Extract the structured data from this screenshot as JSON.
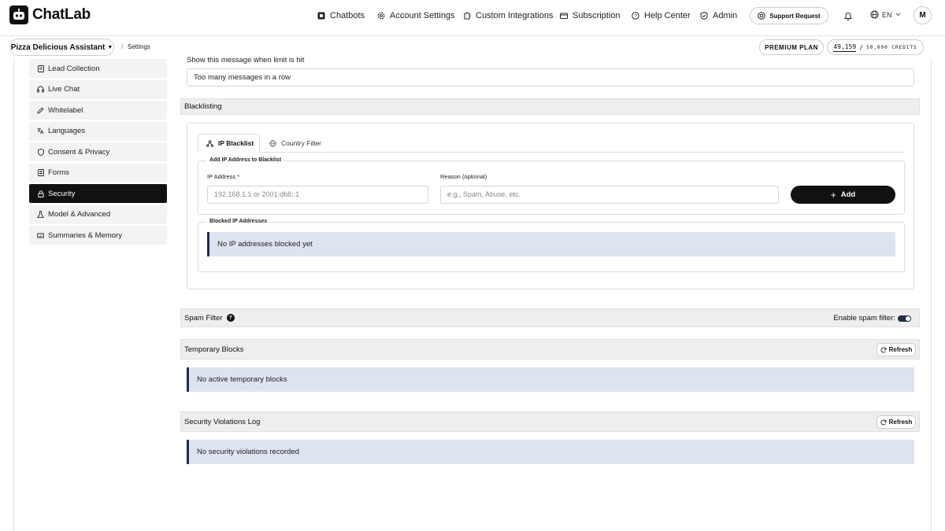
{
  "app": {
    "name": "ChatLab"
  },
  "nav": {
    "chatbots": "Chatbots",
    "account_settings": "Account Settings",
    "custom_integrations": "Custom Integrations",
    "subscription": "Subscription",
    "help_center": "Help Center",
    "admin": "Admin"
  },
  "header": {
    "support_request": "Support Request",
    "language": "EN",
    "avatar_initial": "M"
  },
  "subbar": {
    "bot_name": "Pizza Delicious Assistant",
    "breadcrumb": "Settings",
    "plan": "PREMIUM PLAN",
    "credits_used": "49,159",
    "credits_total": "50,000 CREDITS"
  },
  "sidebar": {
    "items": [
      {
        "label": "Lead Collection",
        "icon": "document-icon",
        "active": false
      },
      {
        "label": "Live Chat",
        "icon": "headset-icon",
        "active": false
      },
      {
        "label": "Whitelabel",
        "icon": "pen-icon",
        "active": false
      },
      {
        "label": "Languages",
        "icon": "translate-icon",
        "active": false
      },
      {
        "label": "Consent & Privacy",
        "icon": "shield-icon",
        "active": false
      },
      {
        "label": "Forms",
        "icon": "form-icon",
        "active": false
      },
      {
        "label": "Security",
        "icon": "lock-icon",
        "active": true
      },
      {
        "label": "Model & Advanced",
        "icon": "flask-icon",
        "active": false
      },
      {
        "label": "Summaries & Memory",
        "icon": "keyboard-icon",
        "active": false
      }
    ]
  },
  "rate_limit": {
    "message_label": "Show this message when limit is hit",
    "message_value": "Too many messages in a row"
  },
  "blacklisting": {
    "title": "Blacklisting",
    "tabs": {
      "ip_blacklist": "IP Blacklist",
      "country_filter": "Country Filter"
    },
    "add_legend": "Add IP Address to Blacklist",
    "ip_label": "IP Address *",
    "ip_placeholder": "192.168.1.1 or 2001:db8::1",
    "reason_label": "Reason (optional)",
    "reason_placeholder": "e.g., Spam, Abuse, etc.",
    "add_button": "Add",
    "blocked_legend": "Blocked IP Addresses",
    "blocked_empty": "No IP addresses blocked yet"
  },
  "spam_filter": {
    "title": "Spam Filter",
    "enable_label": "Enable spam filter:",
    "enabled": true
  },
  "temporary_blocks": {
    "title": "Temporary Blocks",
    "refresh": "Refresh",
    "empty": "No active temporary blocks"
  },
  "violations_log": {
    "title": "Security Violations Log",
    "refresh": "Refresh",
    "empty": "No security violations recorded"
  },
  "colors": {
    "accent": "#111111",
    "alert_bg": "#dde3ef",
    "alert_border": "#1f2c4a",
    "section_bg": "#eeeeee"
  }
}
